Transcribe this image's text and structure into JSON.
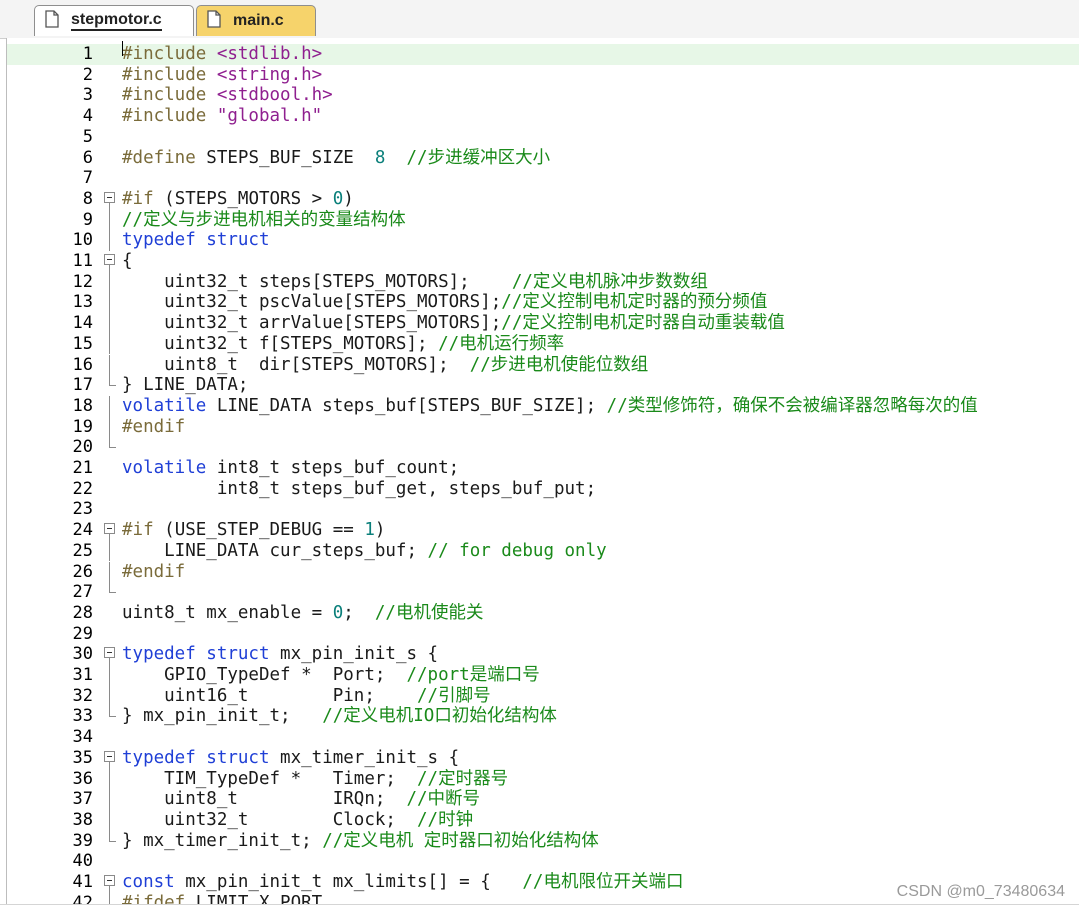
{
  "tabs": [
    {
      "label": "stepmotor.c",
      "active": true
    },
    {
      "label": "main.c",
      "active": false
    }
  ],
  "lines": [
    {
      "n": "1",
      "fold": "",
      "current": true,
      "segs": [
        {
          "c": "pp",
          "t": "#include "
        },
        {
          "c": "inc",
          "t": "<stdlib.h>"
        }
      ]
    },
    {
      "n": "2",
      "fold": "",
      "segs": [
        {
          "c": "pp",
          "t": "#include "
        },
        {
          "c": "inc",
          "t": "<string.h>"
        }
      ]
    },
    {
      "n": "3",
      "fold": "",
      "segs": [
        {
          "c": "pp",
          "t": "#include "
        },
        {
          "c": "inc",
          "t": "<stdbool.h>"
        }
      ]
    },
    {
      "n": "4",
      "fold": "",
      "segs": [
        {
          "c": "pp",
          "t": "#include "
        },
        {
          "c": "inc",
          "t": "\"global.h\""
        }
      ]
    },
    {
      "n": "5",
      "fold": "",
      "segs": []
    },
    {
      "n": "6",
      "fold": "",
      "segs": [
        {
          "c": "pp",
          "t": "#define "
        },
        {
          "c": "",
          "t": "STEPS_BUF_SIZE  "
        },
        {
          "c": "num",
          "t": "8"
        },
        {
          "c": "",
          "t": "  "
        },
        {
          "c": "cm",
          "t": "//步进缓冲区大小"
        }
      ]
    },
    {
      "n": "7",
      "fold": "",
      "segs": []
    },
    {
      "n": "8",
      "fold": "open",
      "segs": [
        {
          "c": "pp",
          "t": "#if "
        },
        {
          "c": "",
          "t": "(STEPS_MOTORS > "
        },
        {
          "c": "num",
          "t": "0"
        },
        {
          "c": "",
          "t": ")"
        }
      ]
    },
    {
      "n": "9",
      "fold": "bar",
      "segs": [
        {
          "c": "cm",
          "t": "//定义与步进电机相关的变量结构体"
        }
      ]
    },
    {
      "n": "10",
      "fold": "bar",
      "segs": [
        {
          "c": "kw",
          "t": "typedef struct"
        }
      ]
    },
    {
      "n": "11",
      "fold": "open",
      "segs": [
        {
          "c": "",
          "t": "{"
        }
      ]
    },
    {
      "n": "12",
      "fold": "bar",
      "segs": [
        {
          "c": "",
          "t": "    uint32_t steps[STEPS_MOTORS];    "
        },
        {
          "c": "cm",
          "t": "//定义电机脉冲步数数组"
        }
      ]
    },
    {
      "n": "13",
      "fold": "bar",
      "segs": [
        {
          "c": "",
          "t": "    uint32_t pscValue[STEPS_MOTORS];"
        },
        {
          "c": "cm",
          "t": "//定义控制电机定时器的预分频值"
        }
      ]
    },
    {
      "n": "14",
      "fold": "bar",
      "segs": [
        {
          "c": "",
          "t": "    uint32_t arrValue[STEPS_MOTORS];"
        },
        {
          "c": "cm",
          "t": "//定义控制电机定时器自动重装载值"
        }
      ]
    },
    {
      "n": "15",
      "fold": "bar",
      "segs": [
        {
          "c": "",
          "t": "    uint32_t f[STEPS_MOTORS]; "
        },
        {
          "c": "cm",
          "t": "//电机运行频率"
        }
      ]
    },
    {
      "n": "16",
      "fold": "bar",
      "segs": [
        {
          "c": "",
          "t": "    uint8_t  dir[STEPS_MOTORS];  "
        },
        {
          "c": "cm",
          "t": "//步进电机使能位数组"
        }
      ]
    },
    {
      "n": "17",
      "fold": "end",
      "segs": [
        {
          "c": "",
          "t": "} LINE_DATA;"
        }
      ]
    },
    {
      "n": "18",
      "fold": "bar",
      "segs": [
        {
          "c": "kw",
          "t": "volatile "
        },
        {
          "c": "",
          "t": "LINE_DATA steps_buf[STEPS_BUF_SIZE]; "
        },
        {
          "c": "cm",
          "t": "//类型修饰符，确保不会被编译器忽略每次的值"
        }
      ]
    },
    {
      "n": "19",
      "fold": "bar",
      "segs": [
        {
          "c": "pp",
          "t": "#endif"
        }
      ]
    },
    {
      "n": "20",
      "fold": "end",
      "segs": []
    },
    {
      "n": "21",
      "fold": "",
      "segs": [
        {
          "c": "kw",
          "t": "volatile "
        },
        {
          "c": "",
          "t": "int8_t steps_buf_count;"
        }
      ]
    },
    {
      "n": "22",
      "fold": "",
      "segs": [
        {
          "c": "",
          "t": "         int8_t steps_buf_get, steps_buf_put;"
        }
      ]
    },
    {
      "n": "23",
      "fold": "",
      "segs": []
    },
    {
      "n": "24",
      "fold": "open",
      "segs": [
        {
          "c": "pp",
          "t": "#if "
        },
        {
          "c": "",
          "t": "(USE_STEP_DEBUG == "
        },
        {
          "c": "num",
          "t": "1"
        },
        {
          "c": "",
          "t": ")"
        }
      ]
    },
    {
      "n": "25",
      "fold": "bar",
      "segs": [
        {
          "c": "",
          "t": "    LINE_DATA cur_steps_buf; "
        },
        {
          "c": "cm",
          "t": "// for debug only"
        }
      ]
    },
    {
      "n": "26",
      "fold": "bar",
      "segs": [
        {
          "c": "pp",
          "t": "#endif"
        }
      ]
    },
    {
      "n": "27",
      "fold": "end",
      "segs": []
    },
    {
      "n": "28",
      "fold": "",
      "segs": [
        {
          "c": "",
          "t": "uint8_t mx_enable = "
        },
        {
          "c": "num",
          "t": "0"
        },
        {
          "c": "",
          "t": ";  "
        },
        {
          "c": "cm",
          "t": "//电机使能关"
        }
      ]
    },
    {
      "n": "29",
      "fold": "",
      "segs": []
    },
    {
      "n": "30",
      "fold": "open",
      "segs": [
        {
          "c": "kw",
          "t": "typedef struct "
        },
        {
          "c": "",
          "t": "mx_pin_init_s {"
        }
      ]
    },
    {
      "n": "31",
      "fold": "bar",
      "segs": [
        {
          "c": "",
          "t": "    GPIO_TypeDef *  Port;  "
        },
        {
          "c": "cm",
          "t": "//port是端口号"
        }
      ]
    },
    {
      "n": "32",
      "fold": "bar",
      "segs": [
        {
          "c": "",
          "t": "    uint16_t        Pin;    "
        },
        {
          "c": "cm",
          "t": "//引脚号"
        }
      ]
    },
    {
      "n": "33",
      "fold": "end",
      "segs": [
        {
          "c": "",
          "t": "} mx_pin_init_t;   "
        },
        {
          "c": "cm",
          "t": "//定义电机IO口初始化结构体"
        }
      ]
    },
    {
      "n": "34",
      "fold": "",
      "segs": []
    },
    {
      "n": "35",
      "fold": "open",
      "segs": [
        {
          "c": "kw",
          "t": "typedef struct "
        },
        {
          "c": "",
          "t": "mx_timer_init_s {"
        }
      ]
    },
    {
      "n": "36",
      "fold": "bar",
      "segs": [
        {
          "c": "",
          "t": "    TIM_TypeDef *   Timer;  "
        },
        {
          "c": "cm",
          "t": "//定时器号"
        }
      ]
    },
    {
      "n": "37",
      "fold": "bar",
      "segs": [
        {
          "c": "",
          "t": "    uint8_t         IRQn;  "
        },
        {
          "c": "cm",
          "t": "//中断号"
        }
      ]
    },
    {
      "n": "38",
      "fold": "bar",
      "segs": [
        {
          "c": "",
          "t": "    uint32_t        Clock;  "
        },
        {
          "c": "cm",
          "t": "//时钟"
        }
      ]
    },
    {
      "n": "39",
      "fold": "end",
      "segs": [
        {
          "c": "",
          "t": "} mx_timer_init_t; "
        },
        {
          "c": "cm",
          "t": "//定义电机 定时器口初始化结构体"
        }
      ]
    },
    {
      "n": "40",
      "fold": "",
      "segs": []
    },
    {
      "n": "41",
      "fold": "open",
      "segs": [
        {
          "c": "kw",
          "t": "const "
        },
        {
          "c": "",
          "t": "mx_pin_init_t mx_limits[] = {   "
        },
        {
          "c": "cm",
          "t": "//电机限位开关端口"
        }
      ]
    },
    {
      "n": "42",
      "fold": "bar",
      "segs": [
        {
          "c": "pp",
          "t": "#ifdef "
        },
        {
          "c": "",
          "t": "LIMIT_X_PORT"
        }
      ]
    }
  ],
  "watermark": "CSDN @m0_73480634"
}
